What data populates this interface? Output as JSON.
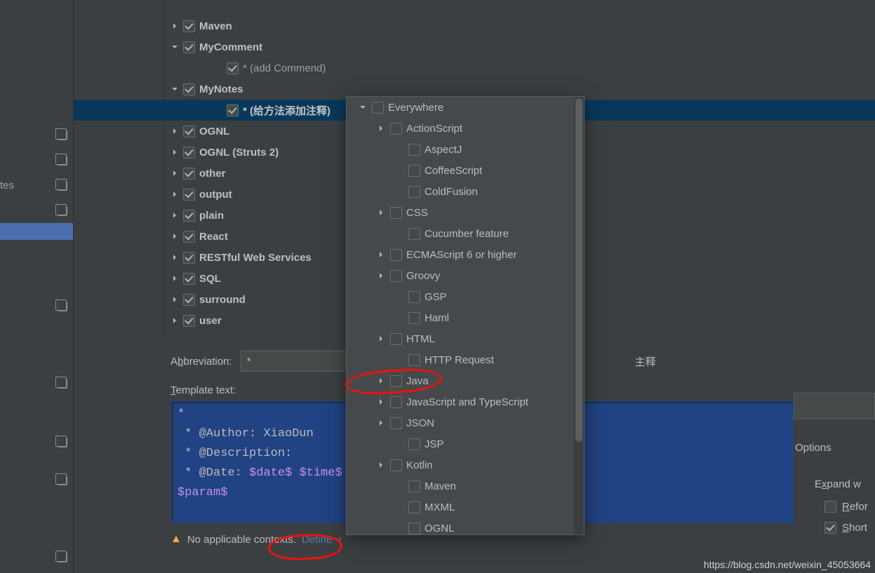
{
  "left_sidebar": {
    "item_text": "tes"
  },
  "tree": [
    {
      "type": "group",
      "label": "Maven",
      "arrow": "right",
      "checked": true
    },
    {
      "type": "group",
      "label": "MyComment",
      "arrow": "down",
      "checked": true
    },
    {
      "type": "sub",
      "label": "* (add Commend)",
      "checked": true,
      "indent": 2
    },
    {
      "type": "group",
      "label": "MyNotes",
      "arrow": "down",
      "checked": true
    },
    {
      "type": "subsel",
      "label": "* (给方法添加注释)",
      "checked": true,
      "indent": 2
    },
    {
      "type": "group",
      "label": "OGNL",
      "arrow": "right",
      "checked": true
    },
    {
      "type": "group",
      "label": "OGNL (Struts 2)",
      "arrow": "right",
      "checked": true
    },
    {
      "type": "group",
      "label": "other",
      "arrow": "right",
      "checked": true
    },
    {
      "type": "group",
      "label": "output",
      "arrow": "right",
      "checked": true
    },
    {
      "type": "group",
      "label": "plain",
      "arrow": "right",
      "checked": true
    },
    {
      "type": "group",
      "label": "React",
      "arrow": "right",
      "checked": true
    },
    {
      "type": "group",
      "label": "RESTful Web Services",
      "arrow": "right",
      "checked": true
    },
    {
      "type": "group",
      "label": "SQL",
      "arrow": "right",
      "checked": true
    },
    {
      "type": "group",
      "label": "surround",
      "arrow": "right",
      "checked": true
    },
    {
      "type": "group",
      "label": "user",
      "arrow": "right",
      "checked": true
    }
  ],
  "form": {
    "abbreviation_label": "Abbreviation:",
    "abbreviation_value": "*",
    "description_suffix": "主释",
    "template_label": "Template text:",
    "template_lines": {
      "l1": "*",
      "l2": " * @Author: XiaoDun",
      "l3": " * @Description:",
      "l4_a": " * @Date: ",
      "l4_b": "$date$ $time$",
      "l5": "$param$"
    },
    "warn_text": "No applicable contexts.",
    "define_label": "Define"
  },
  "popup": [
    {
      "label": "Everywhere",
      "arrow": "down",
      "indent": "A"
    },
    {
      "label": "ActionScript",
      "arrow": "right",
      "indent": "B"
    },
    {
      "label": "AspectJ",
      "arrow": "",
      "indent": "C"
    },
    {
      "label": "CoffeeScript",
      "arrow": "",
      "indent": "C"
    },
    {
      "label": "ColdFusion",
      "arrow": "",
      "indent": "C"
    },
    {
      "label": "CSS",
      "arrow": "right",
      "indent": "B"
    },
    {
      "label": "Cucumber feature",
      "arrow": "",
      "indent": "C"
    },
    {
      "label": "ECMAScript 6 or higher",
      "arrow": "right",
      "indent": "B"
    },
    {
      "label": "Groovy",
      "arrow": "right",
      "indent": "B"
    },
    {
      "label": "GSP",
      "arrow": "",
      "indent": "C"
    },
    {
      "label": "Haml",
      "arrow": "",
      "indent": "C"
    },
    {
      "label": "HTML",
      "arrow": "right",
      "indent": "B"
    },
    {
      "label": "HTTP Request",
      "arrow": "",
      "indent": "C"
    },
    {
      "label": "Java",
      "arrow": "right",
      "indent": "B"
    },
    {
      "label": "JavaScript and TypeScript",
      "arrow": "right",
      "indent": "B"
    },
    {
      "label": "JSON",
      "arrow": "right",
      "indent": "B"
    },
    {
      "label": "JSP",
      "arrow": "",
      "indent": "C"
    },
    {
      "label": "Kotlin",
      "arrow": "right",
      "indent": "B"
    },
    {
      "label": "Maven",
      "arrow": "",
      "indent": "C"
    },
    {
      "label": "MXML",
      "arrow": "",
      "indent": "C"
    },
    {
      "label": "OGNL",
      "arrow": "",
      "indent": "C"
    }
  ],
  "right": {
    "options_label": "Options",
    "expand_label": "Expand w",
    "refor_label": "Refor",
    "short_label": "Short"
  },
  "watermark": "https://blog.csdn.net/weixin_45053664"
}
